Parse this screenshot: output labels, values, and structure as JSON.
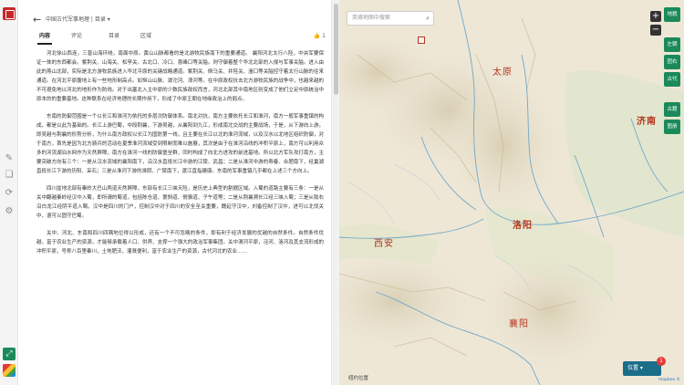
{
  "book": {
    "title": "中国古代军事地理 | 目录",
    "back_icon": "arrow-left",
    "dropdown_icon": "chevron-down"
  },
  "tabs": [
    {
      "label": "内容",
      "active": true
    },
    {
      "label": "评论",
      "active": false
    },
    {
      "label": "目录",
      "active": false
    },
    {
      "label": "区域",
      "active": false
    }
  ],
  "likes": "1",
  "paragraphs": [
    "河北徐山西连，三晋山海环绕，南面中原。黄山山脉都看的是北游牧民族南下的重要通道。 襄阳河北太行八陉，中央军要保证一体的东西都会。紫荆关、山海关、松亭关、古北口、冷口、喜峰口等关隘。则守御着整个华北北部的入侵与军事关隘。进入由此的燕山北部，实际是北方游牧民族进入华北平原的关键战略通道。紫荆关、倒马关、井陉关、滏口等关隘控守着太行山脉的往来通道。在河北平原腹地上有一些地形制高点。如恒山山脉、滹沱河、漳河等。在中原政权抗击北方游牧民族的战争中，也越来越的不可避免地以河北的地形作为防线。对于出塞北入主中原的少数民族政权而言，河北北部其中南地区则变成了他们立足中原统治中原本的的重要基地。这种联系在经济地理的长期作用下，形成了中原王朝在地缘政治上的弱点。",
    "东南的防御范围是一个以长江和淮河为依托的多层次防御体系。南北对抗，南方主要依托长江和淮河，南方一般军事重镇的构成，都是以此为基础的。长江上游巴蜀，中段荆襄，下游吴越，从襄阳到九江，形成南北交战的主要战场，于是，从下游向上游，即吴越与荆襄的形势分析，为什么南方政权以长江为国防第一线，且主要在长江以北的淮河流域，以及汉水以北地区组织防御，对于南方，首先是因为北方骑兵的活动在夏季淮河流域受到限制而难以施展，其次是由于在淮河沿线的冲积平原上，南方可以利用众多的河流湖泊水网作为天然屏障，南方在淮河一线的防御堡垒群，同时构成了向北方进攻的前进基地。所以北方军队攻打南方，主要突破方向有三个：一是从汉水流域的襄阳南下，沿汉水直抵长江中游的江陵、武昌；二是从淮河中游的寿春、合肥南下，经巢湖直抵长江下游的历阳、采石；三是从淮河下游的淮阴、广陵南下，渡江直指建康。东南的军事重镇几乎都在上述三个方向上。",
    "四川盆地北部有秦岭大巴山两道天然屏障，东部有长江三峡天险，是历史上典型的割据区域。入蜀的道路主要有三条：一是从关中翻越秦岭经汉中入蜀，即所谓的蜀道，包括陈仓道、褒斜道、傥骆道、子午道等；二是从荆襄溯长江经三峡入蜀；三是从陇右沿白龙江经阴平道入蜀。汉中是四川的门户，控制汉中对于四川的安全至关重要，魏延守汉中，刘备控制了汉中，进可以北伐关中，退可以固守巴蜀。",
    "关中、河北、东南和四川四隅地位得以形成，还有一个不可忽略的条件，即有利于经济发展的优越的自然条件。自然条件优越，富于农业生产的资源，才能够承载着人口、供养、支撑一个强大的政治军事集团。关中渭河平原，泾河、洛河及其支流形成的冲积平原，号称八百里秦川，土地肥沃，灌溉便利，富于农业生产的资源，古代河北的农业……"
  ],
  "map": {
    "search_placeholder": "英德地图中搜索",
    "cities": [
      {
        "name": "太原",
        "bold": false
      },
      {
        "name": "济南",
        "bold": true
      },
      {
        "name": "洛阳",
        "bold": true
      },
      {
        "name": "西安",
        "bold": false
      },
      {
        "name": "襄阳",
        "bold": false
      }
    ],
    "side_buttons": [
      "地貌",
      "左朝",
      "团右",
      "古代",
      "古籍",
      "图册"
    ],
    "zoom_in": "+",
    "zoom_out": "−",
    "location_label": "位置",
    "location_count": "1",
    "scale_label": "纽约位置",
    "attribution": "mapbox ©"
  },
  "colors": {
    "accent_green": "#1b8a5a",
    "city_red": "#b5361f",
    "link_blue": "#2a6fc9"
  }
}
